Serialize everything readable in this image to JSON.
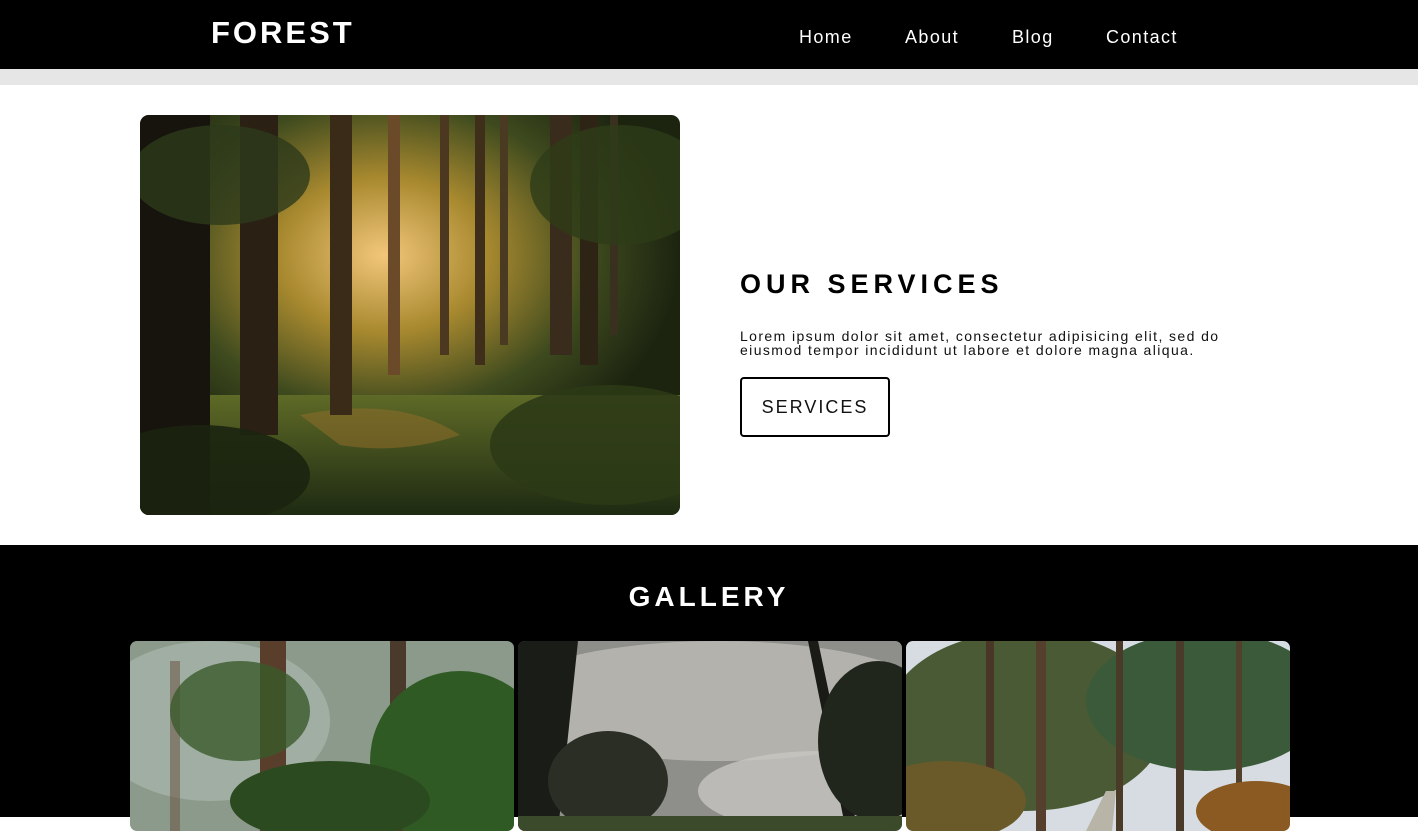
{
  "header": {
    "logo": "FOREST",
    "nav": {
      "home": "Home",
      "about": "About",
      "blog": "Blog",
      "contact": "Contact"
    }
  },
  "services": {
    "title": "OUR SERVICES",
    "text": "Lorem ipsum dolor sit amet, consectetur adipisicing elit, sed do eiusmod tempor incididunt ut labore et dolore magna aliqua.",
    "button_label": "SERVICES"
  },
  "gallery": {
    "title": "GALLERY"
  },
  "colors": {
    "header_bg": "#000000",
    "strip": "#e6e6e6",
    "page_bg": "#ffffff",
    "gallery_bg": "#000000"
  }
}
